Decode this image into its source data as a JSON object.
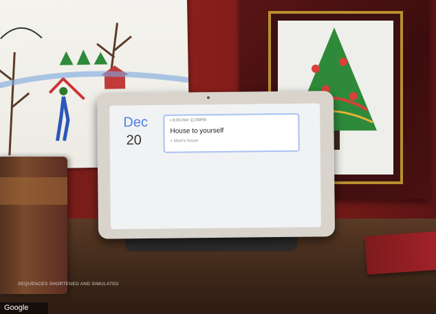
{
  "photo": {
    "subject": "smart-display-on-table",
    "accent": "#4d7fe0"
  },
  "display": {
    "month": "Dec",
    "day": "20",
    "event": {
      "time_range": "• 8:00 AM–11:00PM",
      "title": "House to yourself",
      "location": "Mom's house"
    }
  },
  "caption": "SEQUENCES SHORTENED AND SIMULATED",
  "brand": {
    "label": "Google"
  }
}
